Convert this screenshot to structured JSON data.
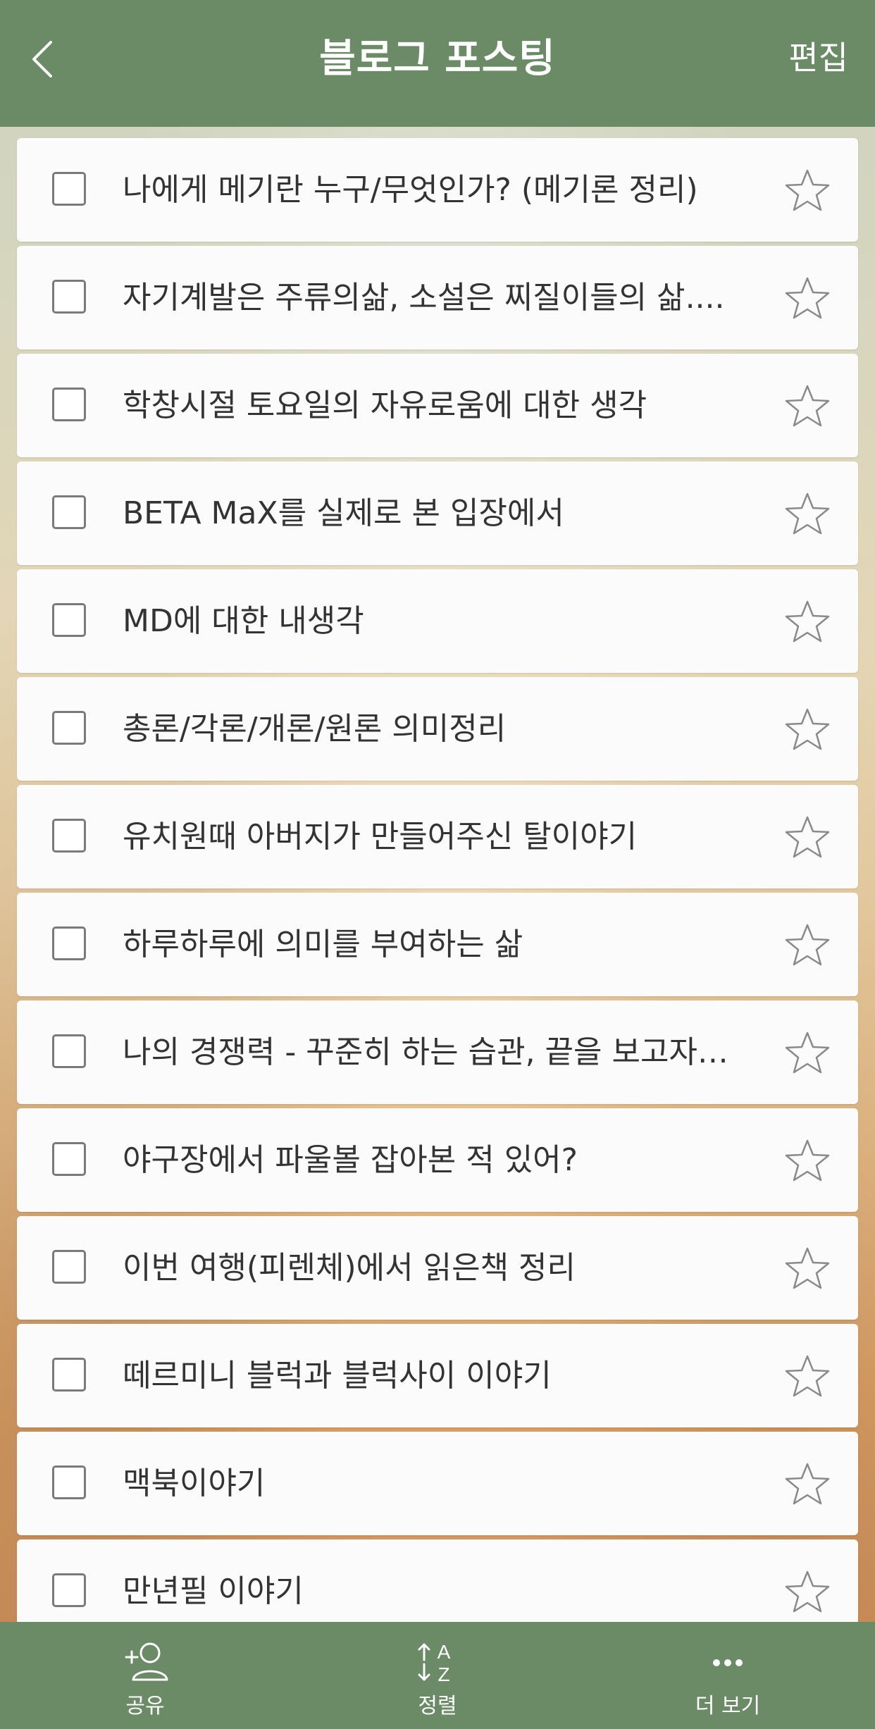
{
  "header": {
    "title": "블로그 포스팅",
    "edit_label": "편집"
  },
  "items": [
    {
      "text": "나에게 메기란 누구/무엇인가? (메기론 정리)",
      "checked": false,
      "starred": false
    },
    {
      "text": "자기계발은 주류의삶, 소설은 찌질이들의 삶....",
      "checked": false,
      "starred": false
    },
    {
      "text": "학창시절 토요일의 자유로움에 대한 생각",
      "checked": false,
      "starred": false
    },
    {
      "text": "BETA MaX를 실제로 본 입장에서",
      "checked": false,
      "starred": false
    },
    {
      "text": "MD에 대한 내생각",
      "checked": false,
      "starred": false
    },
    {
      "text": "총론/각론/개론/원론 의미정리",
      "checked": false,
      "starred": false
    },
    {
      "text": "유치원때 아버지가 만들어주신 탈이야기",
      "checked": false,
      "starred": false
    },
    {
      "text": "하루하루에 의미를 부여하는 삶",
      "checked": false,
      "starred": false
    },
    {
      "text": "나의 경쟁력 - 꾸준히 하는 습관, 끝을 보고자…",
      "checked": false,
      "starred": false
    },
    {
      "text": "야구장에서 파울볼 잡아본 적 있어?",
      "checked": false,
      "starred": false
    },
    {
      "text": "이번 여행(피렌체)에서 읽은책 정리",
      "checked": false,
      "starred": false
    },
    {
      "text": "떼르미니 블럭과 블럭사이 이야기",
      "checked": false,
      "starred": false
    },
    {
      "text": "맥북이야기",
      "checked": false,
      "starred": false
    },
    {
      "text": "만년필 이야기",
      "checked": false,
      "starred": false
    }
  ],
  "bottom_bar": {
    "share_label": "공유",
    "sort_label": "정렬",
    "sort_icon_top": "A",
    "sort_icon_bottom": "Z",
    "more_label": "더 보기"
  },
  "colors": {
    "header_bg": "#6a8b66",
    "bottom_bar_bg": "#6a8b66"
  }
}
